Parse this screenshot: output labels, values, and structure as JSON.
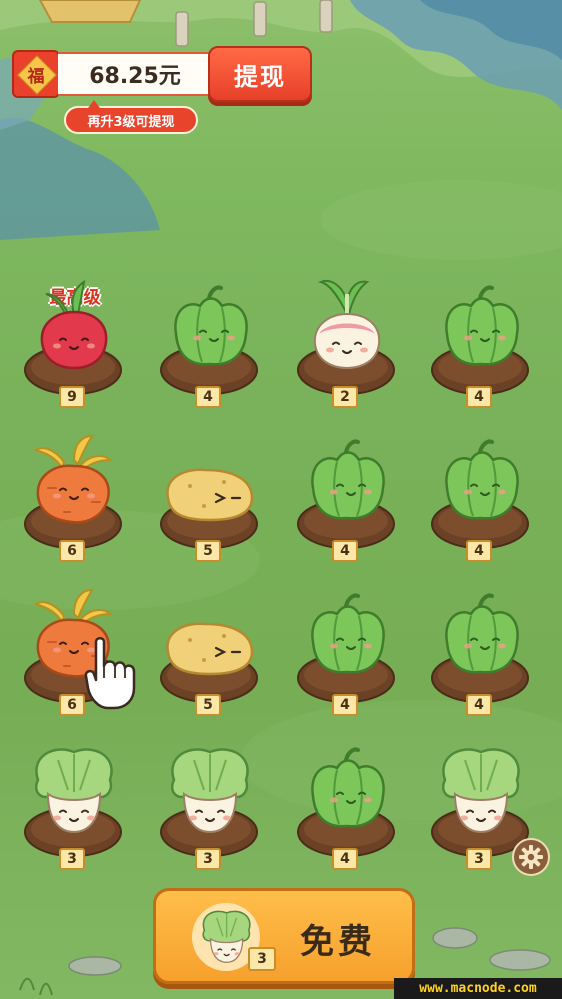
{
  "header": {
    "fu_char": "福",
    "balance": "68.25元",
    "withdraw_label": "提现",
    "level_tip": "再升3级可提现"
  },
  "max_level_tag": "最高级",
  "grid": {
    "rows": [
      [
        {
          "veg": "radish-red",
          "level": "9"
        },
        {
          "veg": "pepper",
          "level": "4"
        },
        {
          "veg": "turnip",
          "level": "2"
        },
        {
          "veg": "pepper",
          "level": "4"
        }
      ],
      [
        {
          "veg": "carrot",
          "level": "6"
        },
        {
          "veg": "potato",
          "level": "5"
        },
        {
          "veg": "pepper",
          "level": "4"
        },
        {
          "veg": "pepper",
          "level": "4"
        }
      ],
      [
        {
          "veg": "carrot",
          "level": "6"
        },
        {
          "veg": "potato",
          "level": "5"
        },
        {
          "veg": "pepper",
          "level": "4"
        },
        {
          "veg": "pepper",
          "level": "4"
        }
      ],
      [
        {
          "veg": "cabbage",
          "level": "3"
        },
        {
          "veg": "cabbage",
          "level": "3"
        },
        {
          "veg": "pepper",
          "level": "4"
        },
        {
          "veg": "cabbage",
          "level": "3"
        }
      ]
    ]
  },
  "free_button": {
    "label": "免费",
    "veg": "cabbage",
    "level": "3"
  },
  "settings_icon": "gear-icon",
  "tutorial_icon": "pointing-hand-icon",
  "watermark": "www.macnode.com",
  "colors": {
    "accent_red": "#e8402a",
    "button_orange": "#f7a02d",
    "level_badge": "#fbe8a8",
    "soil": "#6b4226",
    "grass": "#79b25a"
  }
}
